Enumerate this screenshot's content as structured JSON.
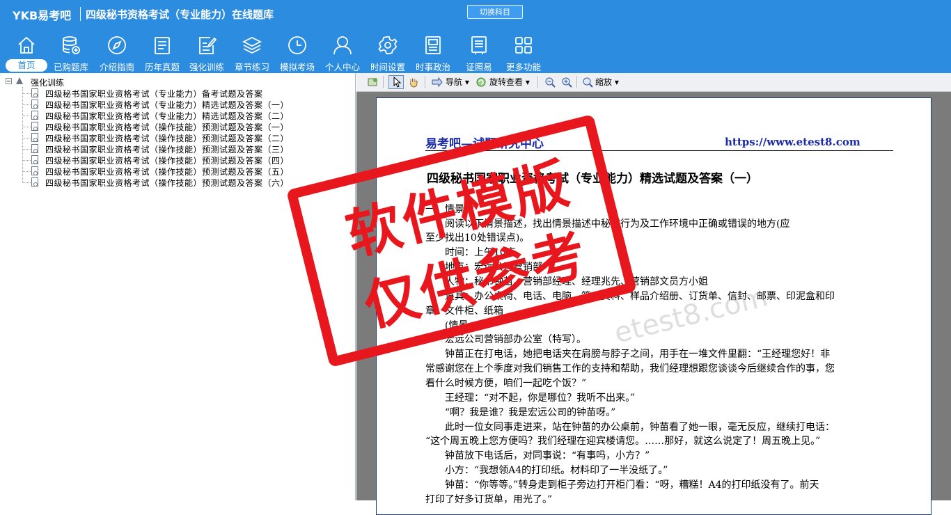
{
  "header": {
    "logo": "YKB易考吧",
    "title": "四级秘书资格考试（专业能力）在线题库",
    "switch_label": "切换科目"
  },
  "nav": [
    {
      "label": "首页",
      "icon": "home-icon",
      "active": true
    },
    {
      "label": "已购题库",
      "icon": "database-icon"
    },
    {
      "label": "介绍指南",
      "icon": "compass-icon"
    },
    {
      "label": "历年真题",
      "icon": "document-list-icon"
    },
    {
      "label": "强化训练",
      "icon": "edit-document-icon"
    },
    {
      "label": "章节练习",
      "icon": "layers-icon"
    },
    {
      "label": "模拟考场",
      "icon": "clock-icon"
    },
    {
      "label": "个人中心",
      "icon": "user-icon"
    },
    {
      "label": "时间设置",
      "icon": "gear-icon"
    },
    {
      "label": "时事政治",
      "icon": "newspaper-icon"
    },
    {
      "label": "证照易",
      "icon": "certificate-icon"
    },
    {
      "label": "更多功能",
      "icon": "grid-icon"
    }
  ],
  "tree": {
    "root": "强化训练",
    "items": [
      "四级秘书国家职业资格考试（专业能力）备考试题及答案",
      "四级秘书国家职业资格考试（专业能力）精选试题及答案（一）",
      "四级秘书国家职业资格考试（专业能力）精选试题及答案（二）",
      "四级秘书国家职业资格考试（操作技能）预测试题及答案（一）",
      "四级秘书国家职业资格考试（操作技能）预测试题及答案（二）",
      "四级秘书国家职业资格考试（操作技能）预测试题及答案（三）",
      "四级秘书国家职业资格考试（操作技能）预测试题及答案（四）",
      "四级秘书国家职业资格考试（操作技能）预测试题及答案（五）",
      "四级秘书国家职业资格考试（操作技能）预测试题及答案（六）"
    ]
  },
  "toolbar": {
    "nav_label": "导航",
    "rotate_label": "旋转查看",
    "zoom_label": "缩放"
  },
  "document": {
    "header_left": "易考吧—试题研究中心",
    "header_right": "https://www.etest8.com",
    "title": "四级秘书国家职业资格考试（专业能力）精选试题及答案（一）",
    "lines": [
      "一、情景题",
      "　　阅读以下情景描述，找出情景描述中秘书行为及工作环境中正确或错误的地方(应",
      "至少找出10处错误点)。",
      "　　时间：上午10点",
      "　　地点：宏远公司营销部",
      "　　人物：秘书钟苗、营销部经理、经理兆先、营销部文员方小姐",
      "　　道具：办公桌椅、电话、电脑、笔、资料、样品介绍册、订货单、信封、邮票、印泥盒和印",
      "章、文件柜、纸箱",
      "　　(情景一)",
      "　　宏远公司营销部办公室（特写）。",
      "　　钟苗正在打电话，她把电话夹在肩膀与脖子之间，用手在一堆文件里翻：“王经理您好！非",
      "常感谢您在上个季度对我们销售工作的支持和帮助，我们经理想跟您谈谈今后继续合作的事，您",
      "看什么时候方便，咱们一起吃个饭？”",
      "　　王经理：“对不起，你是哪位？我听不出来。”",
      "　　“啊？我是谁？我是宏远公司的钟苗呀。”",
      "　　此时一位女同事走进来，站在钟苗的办公桌前，钟苗看了她一眼，毫无反应，继续打电话：",
      "“这个周五晚上您方便吗？我们经理在迎宾楼请您。……那好，就这么说定了！周五晚上见。”",
      "　　钟苗放下电话后，对同事说：“有事吗，小方？”",
      "　　小方：“我想领A4的打印纸。材料印了一半没纸了。”",
      "　　钟苗：“你等等。”转身走到柜子旁边打开柜门看：“呀，糟糕！A4的打印纸没有了。前天",
      "打印了好多订货单，用光了。”"
    ]
  },
  "watermark": {
    "line1": "软件模版",
    "line2": "仅供参考",
    "site": "etest8.com"
  },
  "colors": {
    "header_bg": "#2c8cdf",
    "doc_header": "#1a2aa8",
    "watermark_red": "#e8171d"
  }
}
